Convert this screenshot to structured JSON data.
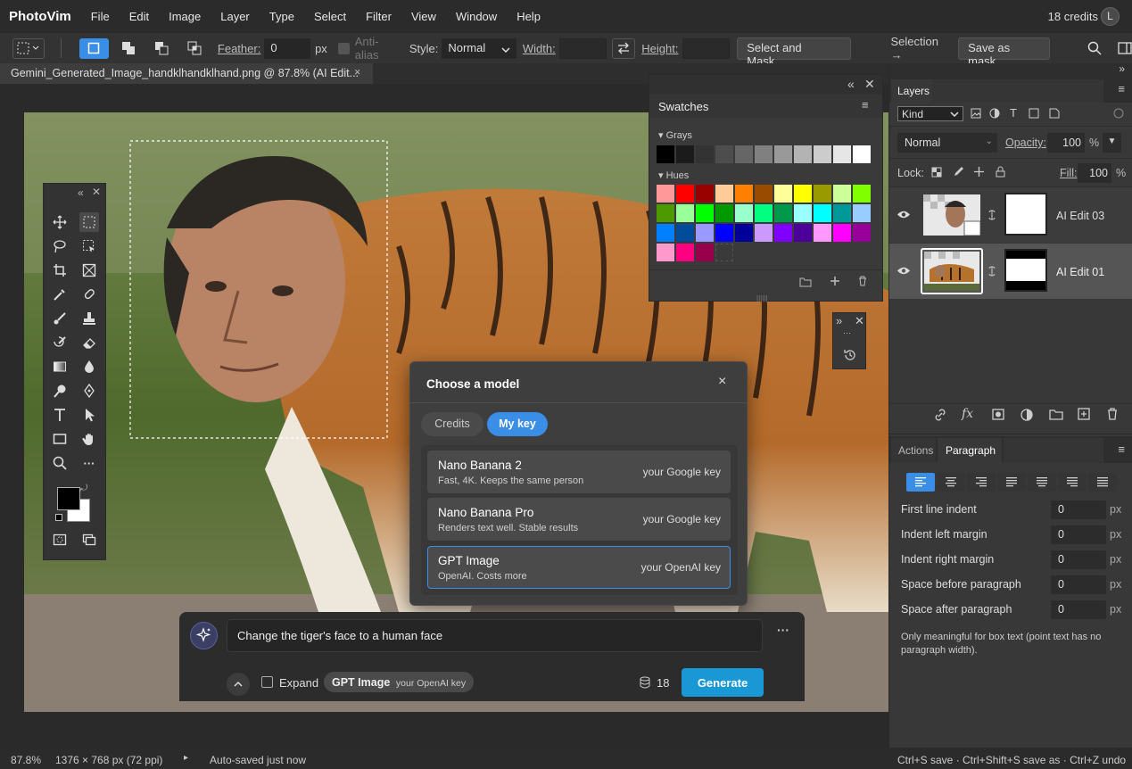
{
  "app": {
    "name": "PhotoVim",
    "credits": "18 credits",
    "avatar": "L"
  },
  "menu": [
    "File",
    "Edit",
    "Image",
    "Layer",
    "Type",
    "Select",
    "Filter",
    "View",
    "Window",
    "Help"
  ],
  "options": {
    "feather_label": "Feather:",
    "feather_value": "0",
    "feather_unit": "px",
    "antialias_label": "Anti-alias",
    "style_label": "Style:",
    "style_value": "Normal",
    "width_label": "Width:",
    "height_label": "Height:",
    "select_mask": "Select and Mask...",
    "selection_arrow": "Selection →",
    "save_mask": "Save as mask"
  },
  "document": {
    "tab_title": "Gemini_Generated_Image_handklhandklhand.png @ 87.8% (AI Edit...",
    "close": "×"
  },
  "swatches": {
    "title": "Swatches",
    "grays_label": "Grays",
    "hues_label": "Hues",
    "grays": [
      "#000000",
      "#1b1b1b",
      "#333333",
      "#4d4d4d",
      "#666666",
      "#808080",
      "#999999",
      "#b3b3b3",
      "#cccccc",
      "#e6e6e6",
      "#ffffff"
    ],
    "hues": [
      "#ff9999",
      "#ff0000",
      "#990000",
      "#ffcc99",
      "#ff8000",
      "#994c00",
      "#ffff99",
      "#ffff00",
      "#999900",
      "#ccff99",
      "#80ff00",
      "#4c9900",
      "#99ff99",
      "#00ff00",
      "#009900",
      "#99ffcc",
      "#00ff80",
      "#00994c",
      "#99ffff",
      "#00ffff",
      "#009999",
      "#99ccff",
      "#0080ff",
      "#004c99",
      "#9999ff",
      "#0000ff",
      "#000099",
      "#cc99ff",
      "#8000ff",
      "#4c0099",
      "#ff99ff",
      "#ff00ff",
      "#990099",
      "#ff99cc",
      "#ff0080",
      "#99004c"
    ]
  },
  "layers_panel": {
    "tab": "Layers",
    "kind": "Kind",
    "blend": "Normal",
    "opacity_label": "Opacity:",
    "opacity_value": "100",
    "percent": "%",
    "lock_label": "Lock:",
    "fill_label": "Fill:",
    "fill_value": "100",
    "layers": [
      {
        "name": "AI Edit 03"
      },
      {
        "name": "AI Edit 01"
      }
    ]
  },
  "paragraph_panel": {
    "tab_actions": "Actions",
    "tab_paragraph": "Paragraph",
    "rows": [
      {
        "label": "First line indent",
        "value": "0",
        "unit": "px"
      },
      {
        "label": "Indent left margin",
        "value": "0",
        "unit": "px"
      },
      {
        "label": "Indent right margin",
        "value": "0",
        "unit": "px"
      },
      {
        "label": "Space before paragraph",
        "value": "0",
        "unit": "px"
      },
      {
        "label": "Space after paragraph",
        "value": "0",
        "unit": "px"
      }
    ],
    "note": "Only meaningful for box text (point text has no paragraph width)."
  },
  "modal": {
    "title": "Choose a model",
    "close": "×",
    "tab_credits": "Credits",
    "tab_mykey": "My key",
    "models": [
      {
        "name": "Nano Banana 2",
        "desc": "Fast, 4K. Keeps the same person",
        "key": "your Google key"
      },
      {
        "name": "Nano Banana Pro",
        "desc": "Renders text well. Stable results",
        "key": "your Google key"
      },
      {
        "name": "GPT Image",
        "desc": "OpenAI. Costs more",
        "key": "your OpenAI key"
      }
    ]
  },
  "prompt": {
    "text": "Change the tiger's face to a human face",
    "more": "···",
    "expand_label": "Expand",
    "chip_model": "GPT Image",
    "chip_key": "your OpenAI key",
    "credits": "18",
    "generate": "Generate"
  },
  "status": {
    "zoom": "87.8%",
    "dimensions": "1376 × 768 px (72 ppi)",
    "caret": "▸",
    "autosave": "Auto-saved just now",
    "shortcuts": "Ctrl+S save · Ctrl+Shift+S save as · Ctrl+Z undo"
  }
}
